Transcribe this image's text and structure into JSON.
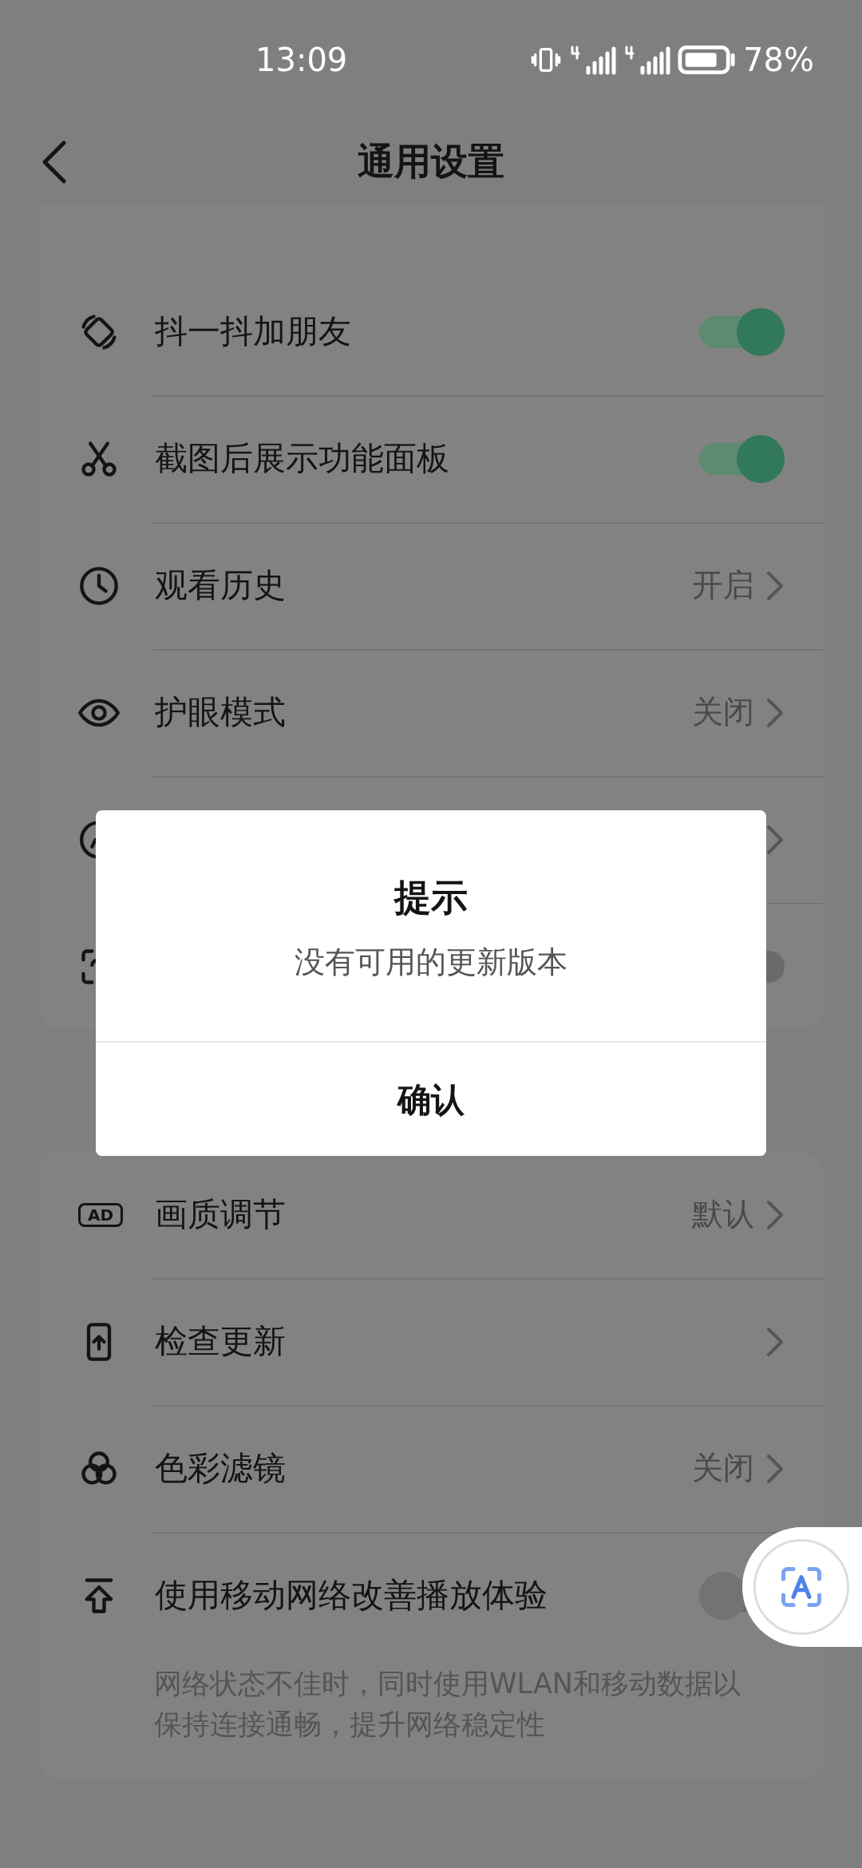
{
  "status_bar": {
    "time": "13:09",
    "battery": "78%"
  },
  "header": {
    "title": "通用设置"
  },
  "groups": [
    {
      "items": [
        {
          "kind": "toggle",
          "label": "抖一抖加朋友",
          "on": true
        },
        {
          "kind": "toggle",
          "label": "截图后展示功能面板",
          "on": true
        },
        {
          "kind": "link",
          "label": "观看历史",
          "value": "开启"
        },
        {
          "kind": "link",
          "label": "护眼模式",
          "value": "关闭"
        },
        {
          "kind": "link"
        },
        {
          "kind": "toggle",
          "on": false
        }
      ]
    },
    {
      "items": [
        {
          "kind": "link",
          "icon_text": "AD",
          "label": "画质调节",
          "value": "默认"
        },
        {
          "kind": "link",
          "label": "检查更新"
        },
        {
          "kind": "link",
          "label": "色彩滤镜",
          "value": "关闭"
        },
        {
          "kind": "toggle",
          "label": "使用移动网络改善播放体验",
          "on": false,
          "description": "网络状态不佳时，同时使用WLAN和移动数据以保持连接通畅，提升网络稳定性"
        }
      ]
    }
  ],
  "dialog": {
    "title": "提示",
    "message": "没有可用的更新版本",
    "button": "确认"
  }
}
